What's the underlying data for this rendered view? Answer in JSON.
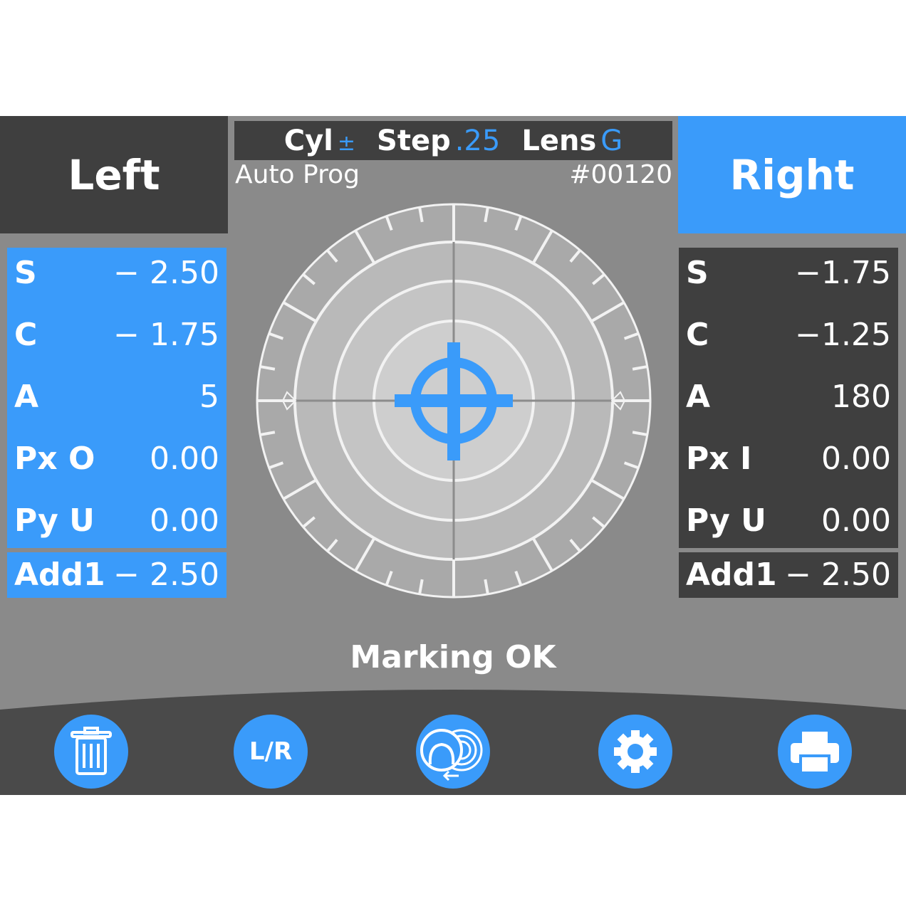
{
  "header": {
    "left_tab": "Left",
    "right_tab": "Right",
    "cyl_label": "Cyl",
    "cyl_value": "±",
    "step_label": "Step",
    "step_value": ".25",
    "lens_label": "Lens",
    "lens_value": "G",
    "mode": "Auto Prog",
    "counter": "#00120"
  },
  "left": {
    "rows": [
      {
        "label": "S",
        "value": "− 2.50"
      },
      {
        "label": "C",
        "value": "− 1.75"
      },
      {
        "label": "A",
        "value": "5"
      },
      {
        "label": "Px O",
        "value": "0.00"
      },
      {
        "label": "Py U",
        "value": "0.00"
      }
    ],
    "add": {
      "label": "Add1",
      "value": "− 2.50"
    }
  },
  "right": {
    "rows": [
      {
        "label": "S",
        "value": "−1.75"
      },
      {
        "label": "C",
        "value": "−1.25"
      },
      {
        "label": "A",
        "value": "180"
      },
      {
        "label": "Px I",
        "value": "0.00"
      },
      {
        "label": "Py U",
        "value": "0.00"
      }
    ],
    "add": {
      "label": "Add1",
      "value": "− 2.50"
    }
  },
  "status": "Marking OK",
  "toolbar": {
    "icons": [
      "trash-icon",
      "left-right-toggle-icon",
      "lens-compare-icon",
      "gear-icon",
      "printer-icon"
    ],
    "lr_label": "L/R"
  },
  "colors": {
    "accent": "#3a9bfa",
    "dark": "#3f3f3f",
    "background": "#8a8a8a",
    "toolbar": "#4a4a4a"
  }
}
